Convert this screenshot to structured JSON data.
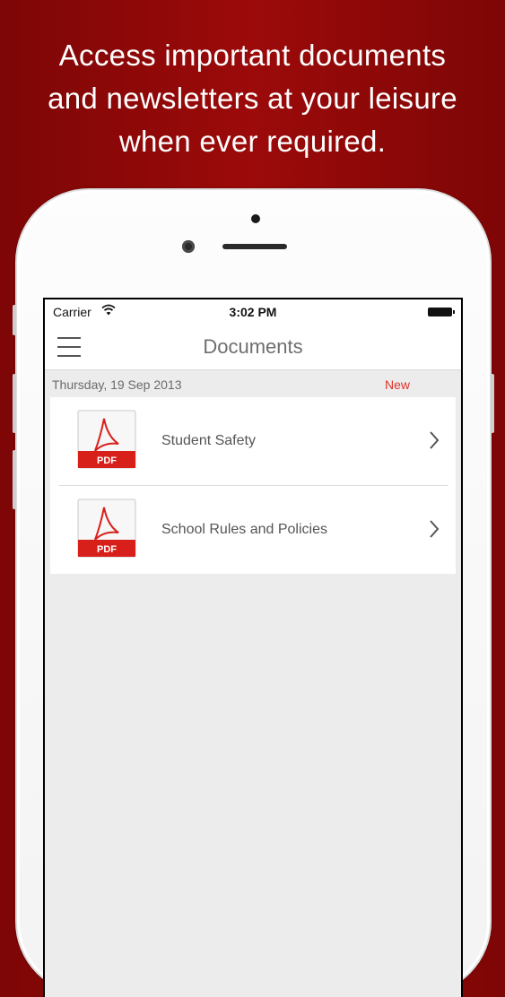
{
  "promo": {
    "line1": "Access important documents",
    "line2": "and newsletters at your leisure",
    "line3": "when ever required."
  },
  "status_bar": {
    "carrier": "Carrier",
    "time": "3:02 PM"
  },
  "nav": {
    "title": "Documents"
  },
  "section": {
    "date": "Thursday, 19 Sep 2013",
    "badge": "New"
  },
  "documents": [
    {
      "label": "Student Safety",
      "icon_text": "PDF",
      "icon": "pdf-icon"
    },
    {
      "label": "School Rules and Policies",
      "icon_text": "PDF",
      "icon": "pdf-icon"
    }
  ],
  "colors": {
    "background": "#9c0a0a",
    "accent_new": "#e0342b",
    "pdf_red": "#d8201b"
  }
}
